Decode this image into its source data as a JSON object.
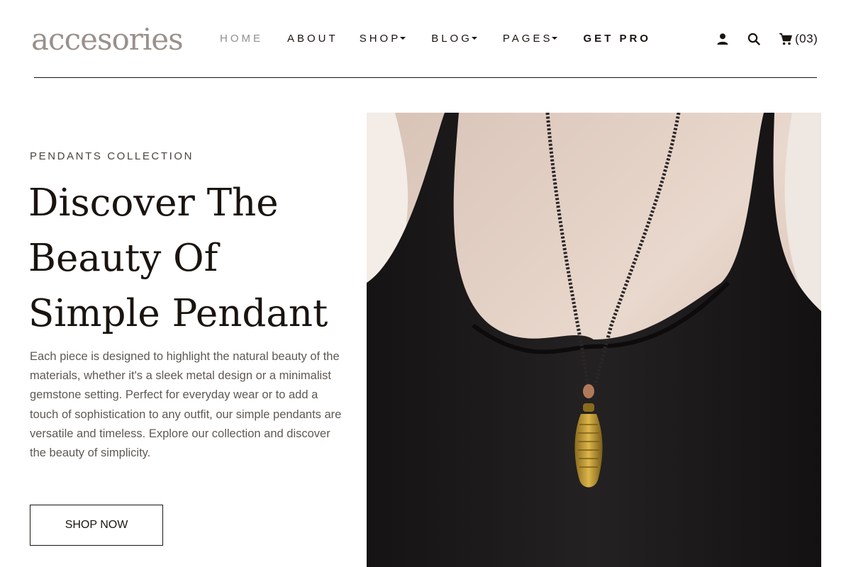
{
  "header": {
    "logo": "accesories",
    "nav": [
      {
        "label": "HOME",
        "dropdown": false
      },
      {
        "label": "ABOUT",
        "dropdown": false
      },
      {
        "label": "SHOP",
        "dropdown": true
      },
      {
        "label": "BLOG",
        "dropdown": true
      },
      {
        "label": "PAGES",
        "dropdown": true
      },
      {
        "label": "GET PRO",
        "dropdown": false
      }
    ],
    "icons": {
      "account": "user-icon",
      "search": "search-icon",
      "cart": "cart-icon"
    },
    "cart_count": "(03)"
  },
  "hero": {
    "eyebrow": "PENDANTS COLLECTION",
    "headline_lines": [
      "Discover The",
      "Beauty Of",
      "Simple Pendant"
    ],
    "description": "Each piece is designed to highlight the natural beauty of the materials, whether it's a sleek metal design or a minimalist gemstone setting. Perfect for everyday wear or to add a touch of sophistication to any outfit, our simple pendants are versatile and timeless. Explore our collection and discover the beauty of simplicity.",
    "cta_label": "SHOP NOW"
  },
  "colors": {
    "text": "#1a1410",
    "muted": "#8f8f8f",
    "body_text": "#5f5853",
    "background": "#ffffff",
    "dress": "#1a1718",
    "pendant_gold": "#c9a23a"
  }
}
